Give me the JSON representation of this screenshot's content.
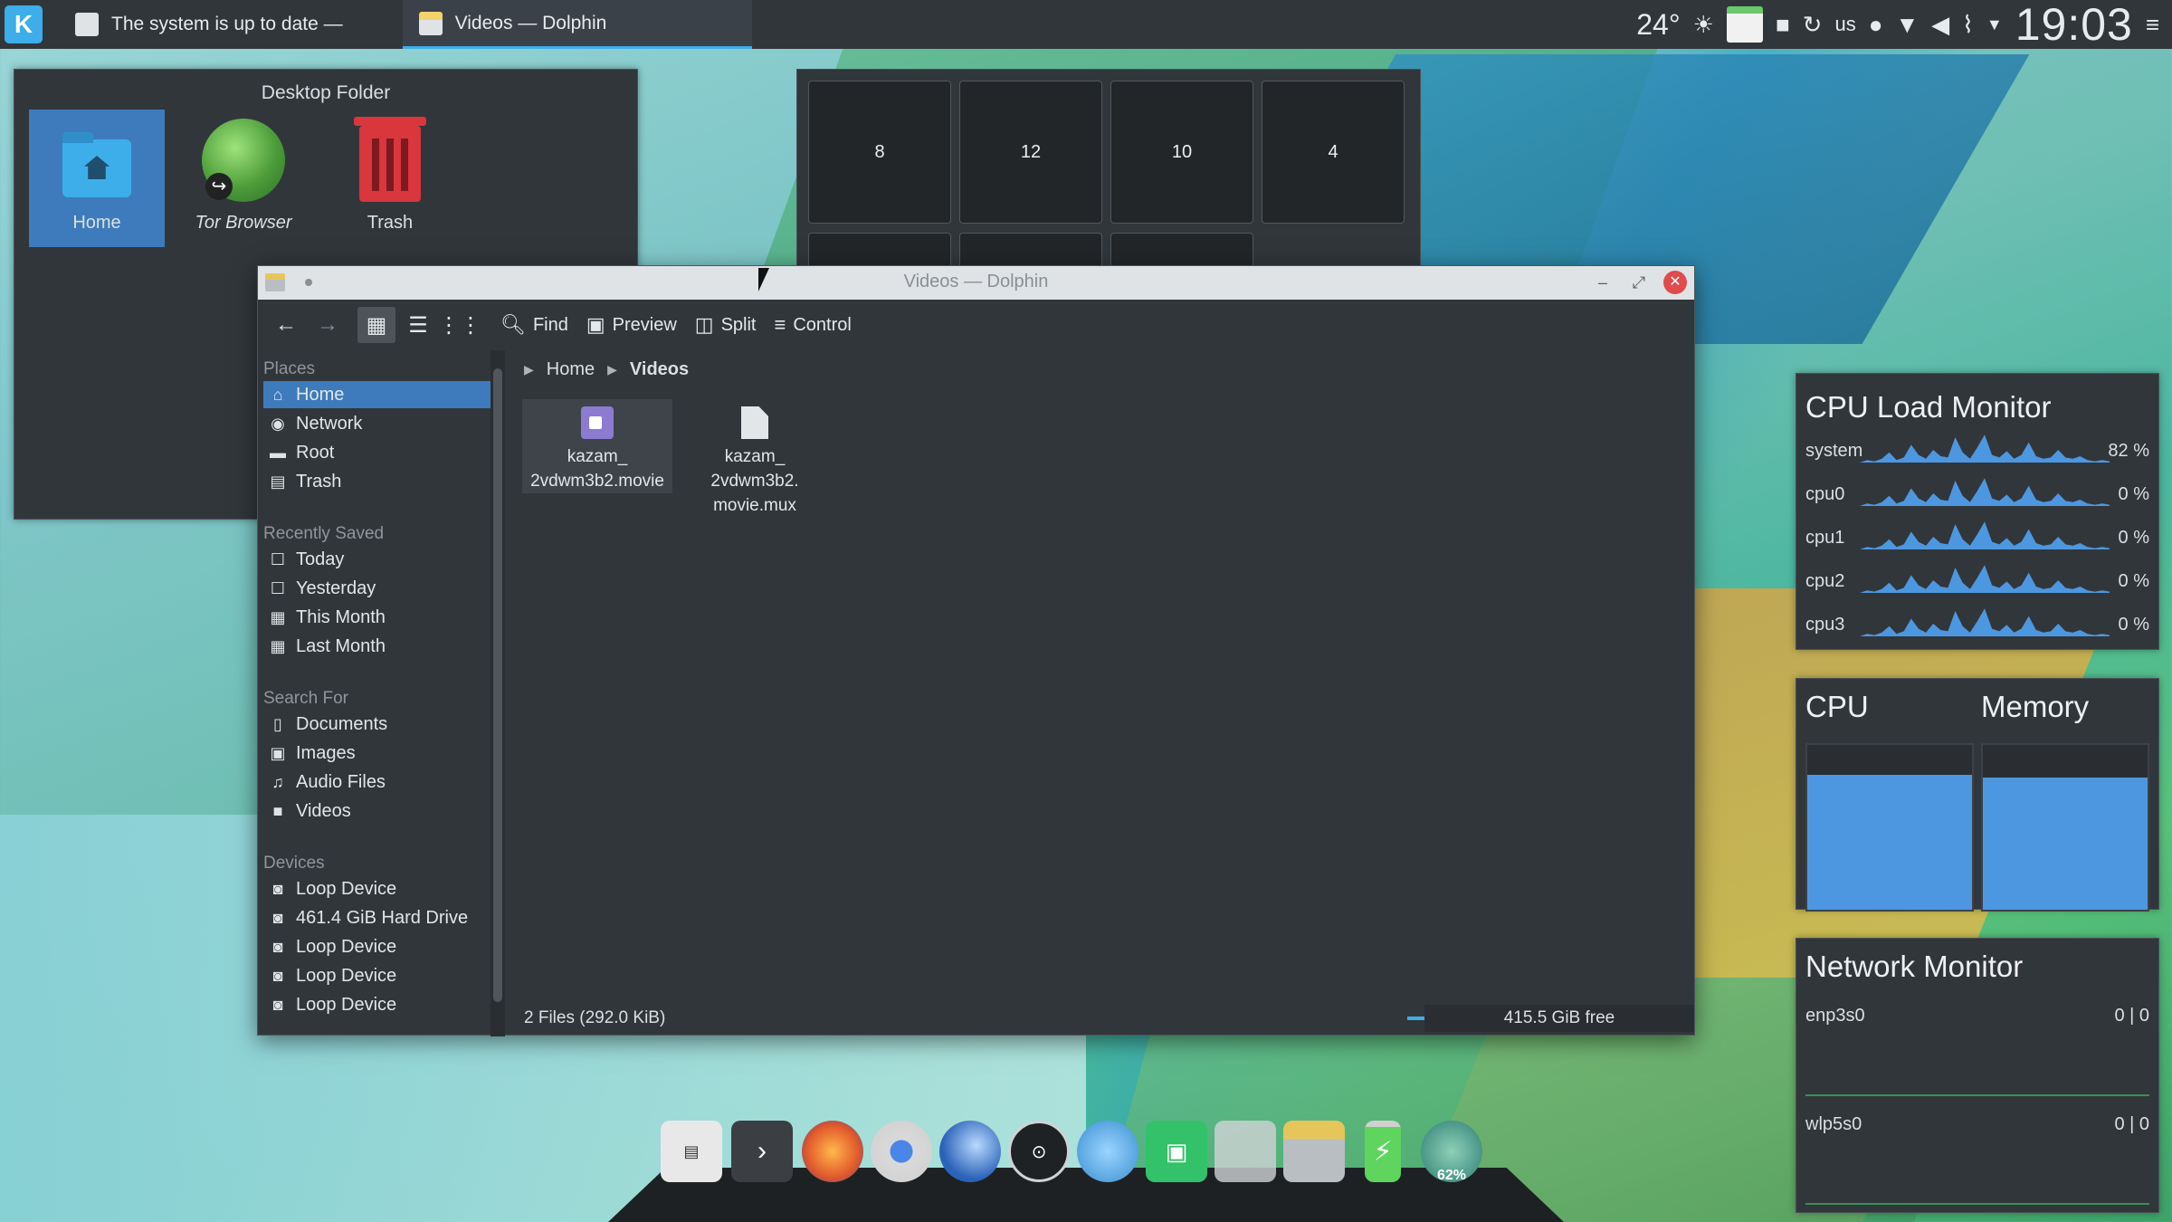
{
  "taskbar": {
    "tasks": [
      {
        "label": "The system is up to date —"
      },
      {
        "label": "Videos — Dolphin"
      }
    ],
    "temperature": "24°",
    "keyboard_layout": "us",
    "clock": "19:03"
  },
  "desktop_folder": {
    "title": "Desktop Folder",
    "icons": [
      {
        "label": "Home"
      },
      {
        "label": "Tor Browser"
      },
      {
        "label": "Trash"
      }
    ]
  },
  "pager": {
    "cells": [
      "8",
      "12",
      "10",
      "4"
    ]
  },
  "dolphin": {
    "title": "Videos — Dolphin",
    "toolbar": {
      "find": "Find",
      "preview": "Preview",
      "split": "Split",
      "control": "Control"
    },
    "places": {
      "sections": {
        "places": "Places",
        "recently_saved": "Recently Saved",
        "search_for": "Search For",
        "devices": "Devices"
      },
      "places_items": [
        "Home",
        "Network",
        "Root",
        "Trash"
      ],
      "recent_items": [
        "Today",
        "Yesterday",
        "This Month",
        "Last Month"
      ],
      "search_items": [
        "Documents",
        "Images",
        "Audio Files",
        "Videos"
      ],
      "device_items": [
        "Loop Device",
        "461.4 GiB Hard Drive",
        "Loop Device",
        "Loop Device",
        "Loop Device"
      ]
    },
    "breadcrumb": [
      "Home",
      "Videos"
    ],
    "files": [
      {
        "name_line1": "kazam_",
        "name_line2": "2vdwm3b2.movie",
        "name_line3": ""
      },
      {
        "name_line1": "kazam_",
        "name_line2": "2vdwm3b2.",
        "name_line3": "movie.mux"
      }
    ],
    "status": {
      "summary": "2 Files (292.0 KiB)",
      "free_space": "415.5 GiB free",
      "zoom_fraction": 0.18
    }
  },
  "cpu_monitor": {
    "title": "CPU Load Monitor",
    "rows": [
      {
        "name": "system",
        "value": "82 %"
      },
      {
        "name": "cpu0",
        "value": "0 %"
      },
      {
        "name": "cpu1",
        "value": "0 %"
      },
      {
        "name": "cpu2",
        "value": "0 %"
      },
      {
        "name": "cpu3",
        "value": "0 %"
      }
    ]
  },
  "cpu_mem": {
    "cpu_label": "CPU",
    "memory_label": "Memory",
    "cpu_fraction": 0.82,
    "memory_fraction": 0.8
  },
  "network_monitor": {
    "title": "Network Monitor",
    "interfaces": [
      {
        "name": "enp3s0",
        "value": "0 | 0"
      },
      {
        "name": "wlp5s0",
        "value": "0 | 0"
      }
    ]
  },
  "dock": {
    "battery_percent_label": "62%"
  },
  "colors": {
    "panel": "#31363b",
    "accent": "#3daee9",
    "selection": "#3d7bbd",
    "graph": "#4d97e0"
  }
}
